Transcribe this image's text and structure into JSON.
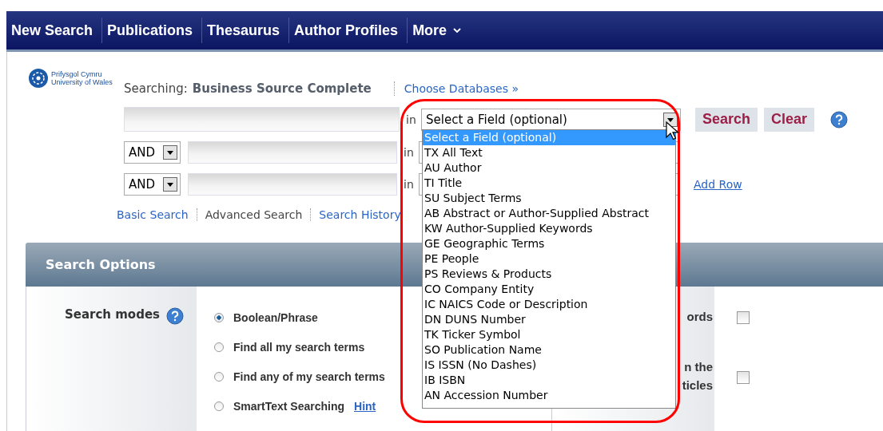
{
  "nav": [
    {
      "label": "New Search",
      "kind": "link"
    },
    {
      "label": "Publications",
      "kind": "link"
    },
    {
      "label": "Thesaurus",
      "kind": "link"
    },
    {
      "label": "Author Profiles",
      "kind": "link"
    },
    {
      "label": "More",
      "kind": "menu"
    }
  ],
  "logo": {
    "lines": [
      "Prifysgol Cymru",
      "University of Wales"
    ]
  },
  "searching": {
    "label": "Searching:",
    "database": "Business Source Complete",
    "link": "Choose Databases »"
  },
  "search_rows": [
    {
      "kind": "first",
      "in_label": "in",
      "field_value": "Select a Field (optional)"
    },
    {
      "kind": "operator",
      "operator": "AND",
      "in_label": "in"
    },
    {
      "kind": "operator",
      "operator": "AND",
      "in_label": "in"
    }
  ],
  "buttons": [
    {
      "label": "Search"
    },
    {
      "label": "Clear"
    }
  ],
  "add_row": "Add Row",
  "links": [
    {
      "label": "Basic Search",
      "selected": false
    },
    {
      "label": "Advanced Search",
      "selected": true
    },
    {
      "label": "Search History",
      "selected": false
    }
  ],
  "field_dropdown": {
    "options": [
      {
        "label": "Select a Field (optional)",
        "selected": true
      },
      {
        "label": "TX All Text",
        "selected": false
      },
      {
        "label": "AU Author",
        "selected": false
      },
      {
        "label": "TI Title",
        "selected": false
      },
      {
        "label": "SU Subject Terms",
        "selected": false
      },
      {
        "label": "AB Abstract or Author-Supplied Abstract",
        "selected": false
      },
      {
        "label": "KW Author-Supplied Keywords",
        "selected": false
      },
      {
        "label": "GE Geographic Terms",
        "selected": false
      },
      {
        "label": "PE People",
        "selected": false
      },
      {
        "label": "PS Reviews & Products",
        "selected": false
      },
      {
        "label": "CO Company Entity",
        "selected": false
      },
      {
        "label": "IC NAICS Code or Description",
        "selected": false
      },
      {
        "label": "DN DUNS Number",
        "selected": false
      },
      {
        "label": "TK Ticker Symbol",
        "selected": false
      },
      {
        "label": "SO Publication Name",
        "selected": false
      },
      {
        "label": "IS ISSN (No Dashes)",
        "selected": false
      },
      {
        "label": "IB ISBN",
        "selected": false
      },
      {
        "label": "AN Accession Number",
        "selected": false
      }
    ]
  },
  "search_options": {
    "title": "Search Options",
    "modes_label": "Search modes",
    "modes": [
      {
        "label": "Boolean/Phrase",
        "selected": true
      },
      {
        "label": "Find all my search terms",
        "selected": false
      },
      {
        "label": "Find any of my search terms",
        "selected": false
      },
      {
        "label": "SmartText Searching",
        "selected": false,
        "link": "Hint"
      }
    ],
    "right_options": [
      {
        "lines": [
          "ords"
        ],
        "checked": false
      },
      {
        "lines": [
          "n the",
          "ticles"
        ],
        "checked": false
      }
    ]
  }
}
